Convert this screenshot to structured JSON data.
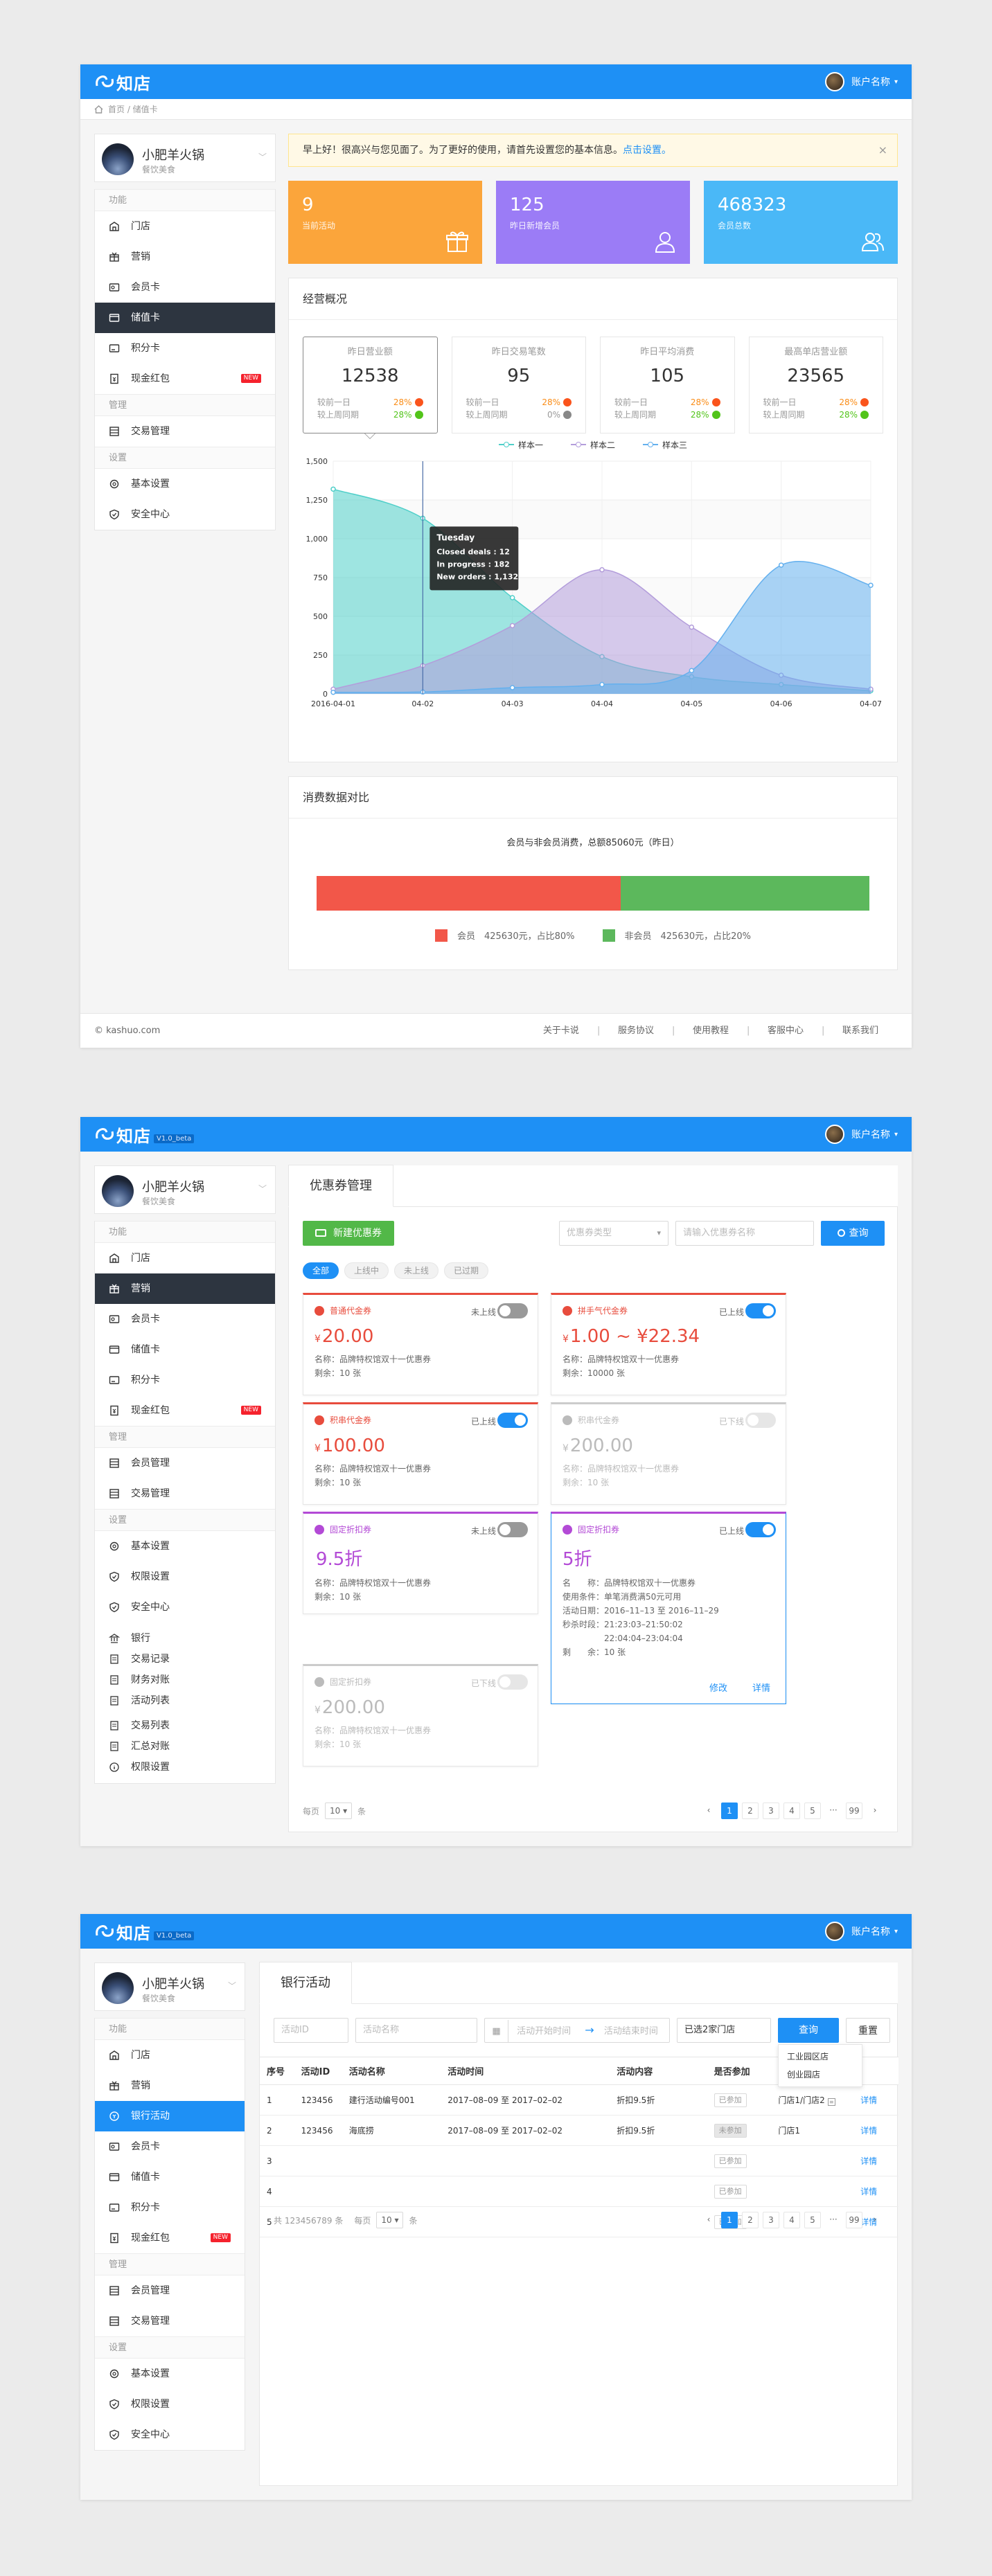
{
  "app": {
    "logo_text": "知店",
    "version": "V1.0_beta",
    "account_name": "账户名称",
    "store_name": "小肥羊火锅",
    "store_type": "餐饮美食",
    "accent_color": "#1e90f5"
  },
  "screen1": {
    "breadcrumb": "首页 / 储值卡",
    "menu": {
      "sec1": "功能",
      "items1": [
        "门店",
        "营销",
        "会员卡",
        "储值卡",
        "积分卡",
        "现金红包"
      ],
      "active_index": 3,
      "new_badge": "NEW",
      "sec2": "管理",
      "items2": [
        "交易管理"
      ],
      "sec3": "设置",
      "items3": [
        "基本设置",
        "安全中心"
      ]
    },
    "notice": {
      "text": "早上好！很高兴与您见面了。为了更好的使用，请首先设置您的基本信息。",
      "link": "点击设置。",
      "close": "×"
    },
    "stats": [
      {
        "value": "9",
        "label": "当前活动",
        "color": "#fba53b",
        "icon": "gift-icon"
      },
      {
        "value": "125",
        "label": "昨日新增会员",
        "color": "#9b7cf6",
        "icon": "user-icon"
      },
      {
        "value": "468323",
        "label": "会员总数",
        "color": "#4ab8f7",
        "icon": "users-icon"
      }
    ],
    "overview": {
      "title": "经营概况",
      "kpis": [
        {
          "title": "昨日营业额",
          "value": "12538",
          "r1_label": "较前一日",
          "r1_val": "28%",
          "r1_dir": "up",
          "r2_label": "较上周同期",
          "r2_val": "28%",
          "r2_dir": "dn"
        },
        {
          "title": "昨日交易笔数",
          "value": "95",
          "r1_label": "较前一日",
          "r1_val": "28%",
          "r1_dir": "up",
          "r2_label": "较上周同期",
          "r2_val": "0%",
          "r2_dir": "eq"
        },
        {
          "title": "昨日平均消费",
          "value": "105",
          "r1_label": "较前一日",
          "r1_val": "28%",
          "r1_dir": "up",
          "r2_label": "较上周同期",
          "r2_val": "28%",
          "r2_dir": "dn"
        },
        {
          "title": "最高单店营业额",
          "value": "23565",
          "r1_label": "较前一日",
          "r1_val": "28%",
          "r1_dir": "up",
          "r2_label": "较上周同期",
          "r2_val": "28%",
          "r2_dir": "dn"
        }
      ]
    },
    "chart_data": {
      "type": "area",
      "x": [
        "2016-04-01",
        "04-02",
        "04-03",
        "04-04",
        "04-05",
        "04-06",
        "04-07"
      ],
      "ylim": [
        0,
        1500
      ],
      "yticks": [
        "0",
        "250",
        "500",
        "750",
        "1,000",
        "1,250",
        "1,500"
      ],
      "grid": true,
      "legend_position": "top",
      "series": [
        {
          "name": "样本一",
          "color": "#4fcfc9",
          "values": [
            1320,
            1132,
            620,
            240,
            110,
            60,
            20
          ]
        },
        {
          "name": "样本二",
          "color": "#b39ddb",
          "values": [
            30,
            182,
            440,
            800,
            430,
            120,
            30
          ]
        },
        {
          "name": "样本三",
          "color": "#64b0ee",
          "values": [
            10,
            12,
            40,
            60,
            150,
            830,
            700
          ]
        }
      ],
      "tooltip": {
        "title": "Tuesday",
        "lines": [
          "Closed deals : 12",
          "In progress : 182",
          "New orders : 1,132"
        ],
        "x_index": 1
      }
    },
    "compare": {
      "title": "消费数据对比",
      "subtitle": "会员与非会员消费，总额85060元（昨日）",
      "member_fraction": 0.55,
      "member_color": "#f25749",
      "nonmember_color": "#5cb85c",
      "member_label": "会员　425630元，占比80%",
      "nonmember_label": "非会员　425630元，占比20%"
    },
    "footer": {
      "copyright": "© kashuo.com",
      "links": [
        "关于卡说",
        "服务协议",
        "使用教程",
        "客服中心",
        "联系我们"
      ]
    }
  },
  "screen2": {
    "menu": {
      "sec1": "功能",
      "items1": [
        "门店",
        "营销",
        "会员卡",
        "储值卡",
        "积分卡",
        "现金红包"
      ],
      "active_index": 1,
      "new_badge": "NEW",
      "sec2": "管理",
      "items2": [
        "会员管理",
        "交易管理"
      ],
      "sec3": "设置",
      "items3": [
        "基本设置",
        "权限设置",
        "安全中心"
      ],
      "extra": [
        "银行",
        "交易记录",
        "财务对账",
        "活动列表",
        "交易列表",
        "汇总对账",
        "权限设置"
      ]
    },
    "tab": "优惠券管理",
    "new_button": "新建优惠券",
    "type_select": "优惠券类型",
    "search_placeholder": "请输入优惠券名称",
    "search_button": "查询",
    "filters": [
      "全部",
      "上线中",
      "未上线",
      "已过期"
    ],
    "coupons": [
      {
        "type": "普通代金券",
        "status": "未上线",
        "on": false,
        "value_prefix": "¥",
        "value": "20.00",
        "name": "名称：品牌特权馆双十一优惠券",
        "left": "剩余：10 张",
        "style": "red"
      },
      {
        "type": "拼手气代金券",
        "status": "已上线",
        "on": true,
        "value_prefix": "¥",
        "value": "1.00 ~ ¥22.34",
        "name": "名称：品牌特权馆双十一优惠券",
        "left": "剩余：10000 张",
        "style": "red"
      },
      {
        "type": "积串代金券",
        "status": "已上线",
        "on": true,
        "value_prefix": "¥",
        "value": "100.00",
        "name": "名称：品牌特权馆双十一优惠券",
        "left": "剩余：10 张",
        "style": "red"
      },
      {
        "type": "积串代金券",
        "status": "已下线",
        "on": false,
        "value_prefix": "¥",
        "value": "200.00",
        "name": "名称：品牌特权馆双十一优惠券",
        "left": "剩余：10 张",
        "style": "gray"
      },
      {
        "type": "固定折扣券",
        "status": "未上线",
        "on": false,
        "value_prefix": "",
        "value": "9.5折",
        "name": "名称：品牌特权馆双十一优惠券",
        "left": "剩余：10 张",
        "style": "purple"
      },
      {
        "type": "固定折扣券",
        "status": "已下线",
        "on": false,
        "value_prefix": "¥",
        "value": "200.00",
        "name": "名称：品牌特权馆双十一优惠券",
        "left": "剩余：10 张",
        "style": "gray"
      }
    ],
    "detail_coupon": {
      "type": "固定折扣券",
      "status": "已上线",
      "value": "5折",
      "lines": [
        "名　　称：品牌特权馆双十一优惠券",
        "使用条件：单笔消费满50元可用",
        "活动日期：2016–11–13 至 2016–11–29",
        "秒杀时段：21:23:03–21:50:02",
        "　　　　　22:04:04–23:04:04",
        "剩　　余：10 张"
      ],
      "edit": "修改",
      "detail": "详情"
    },
    "pager": {
      "per_page_label": "每页",
      "per_page": "10",
      "unit": "条",
      "pages": [
        "‹",
        "1",
        "2",
        "3",
        "4",
        "5",
        "···",
        "99",
        "›"
      ],
      "current": "1"
    }
  },
  "screen3": {
    "menu": {
      "sec1": "功能",
      "items1": [
        "门店",
        "营销",
        "银行活动",
        "会员卡",
        "储值卡",
        "积分卡",
        "现金红包"
      ],
      "active_index": 2,
      "new_badge": "NEW",
      "sec2": "管理",
      "items2": [
        "会员管理",
        "交易管理"
      ],
      "sec3": "设置",
      "items3": [
        "基本设置",
        "权限设置",
        "安全中心"
      ]
    },
    "tab": "银行活动",
    "filters": {
      "activity_id": "活动ID",
      "activity_name": "活动名称",
      "start_time": "活动开始时间",
      "end_time": "活动结束时间",
      "store_select": "已选2家门店",
      "query": "查询",
      "reset": "重置"
    },
    "store_dropdown": [
      "工业园区店",
      "创业园店"
    ],
    "table": {
      "headers": [
        "序号",
        "活动ID",
        "活动名称",
        "活动时间",
        "活动内容",
        "是否参加",
        "参与门店",
        ""
      ],
      "rows": [
        {
          "no": "1",
          "id": "123456",
          "name": "建行活动编号001",
          "time": "2017–08–09 至 2017–02–02",
          "content": "折扣9.5折",
          "join": "已参加",
          "store": "门店1/门店2",
          "op": "详情"
        },
        {
          "no": "2",
          "id": "123456",
          "name": "海底捞",
          "time": "2017–08–09 至 2017–02–02",
          "content": "折扣9.5折",
          "join": "未参加",
          "store": "门店1",
          "op": "详情"
        },
        {
          "no": "3",
          "id": "",
          "name": "",
          "time": "",
          "content": "",
          "join": "已参加",
          "store": "",
          "op": "详情"
        },
        {
          "no": "4",
          "id": "",
          "name": "",
          "time": "",
          "content": "",
          "join": "已参加",
          "store": "",
          "op": "详情"
        },
        {
          "no": "5",
          "id": "",
          "name": "",
          "time": "",
          "content": "",
          "join": "已参加",
          "store": "",
          "op": "详情"
        }
      ]
    },
    "pager": {
      "total": "共 123456789 条",
      "per_page_label": "每页",
      "per_page": "10",
      "unit": "条",
      "pages": [
        "‹",
        "1",
        "2",
        "3",
        "4",
        "5",
        "···",
        "99",
        "›"
      ],
      "current": "1"
    }
  }
}
